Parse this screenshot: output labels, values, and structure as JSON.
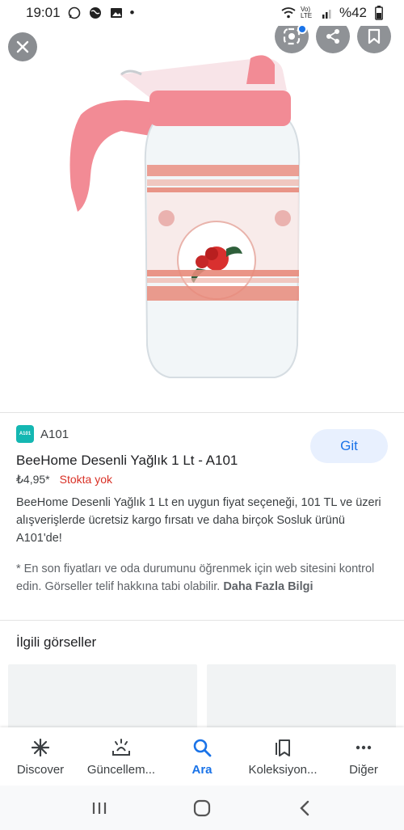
{
  "status_bar": {
    "time": "19:01",
    "dot": "•",
    "network": "Vo) LTE",
    "battery": "%42"
  },
  "product": {
    "source": "A101",
    "source_logo_text": "A101",
    "go_label": "Git",
    "title": "BeeHome Desenli Yağlık 1 Lt - A101",
    "price": "₺4,95*",
    "stock": "Stokta yok",
    "description": "BeeHome Desenli Yağlık 1 Lt en uygun fiyat seçeneği, 101 TL ve üzeri alışverişlerde ücretsiz kargo fırsatı ve daha birçok Sosluk ürünü A101'de!",
    "disclaimer": "* En son fiyatları ve oda durumunu öğrenmek için web sitesini kontrol edin. Görseller telif hakkına tabi olabilir.",
    "more_link": "Daha Fazla Bilgi"
  },
  "related": {
    "title": "İlgili görseller"
  },
  "bottom_nav": [
    {
      "label": "Discover",
      "icon": "asterisk-icon"
    },
    {
      "label": "Güncellem...",
      "icon": "updates-icon"
    },
    {
      "label": "Ara",
      "icon": "search-icon",
      "active": true
    },
    {
      "label": "Koleksiyon...",
      "icon": "collections-icon"
    },
    {
      "label": "Diğer",
      "icon": "more-icon"
    }
  ],
  "colors": {
    "accent": "#1a73e8",
    "stock_red": "#d93025",
    "lid_pink": "#f28b95"
  }
}
